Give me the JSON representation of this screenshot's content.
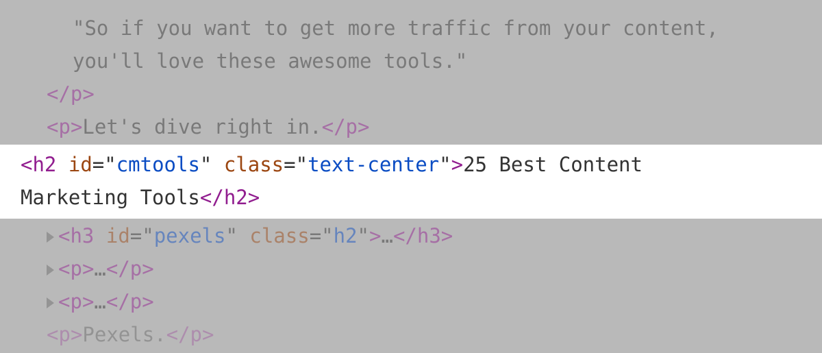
{
  "lines": {
    "text1": "\"So if you want to get more traffic from your content, ",
    "text2": "you'll love these awesome tools.\"",
    "close_p": "</",
    "close_p_name": "p",
    "close_p_end": ">",
    "p_open_l4": "<",
    "p_name_l4": "p",
    "p_gt_l4": ">",
    "p_content_l4": "Let's dive right in.",
    "p_close_l4_open": "</",
    "p_close_l4_name": "p",
    "p_close_l4_gt": ">",
    "h2_open": "<",
    "h2_name": "h2 ",
    "h2_id_attr": "id",
    "h2_eq1": "=\"",
    "h2_id_val": "cmtools",
    "h2_q1": "\" ",
    "h2_class_attr": "class",
    "h2_eq2": "=\"",
    "h2_class_val": "text-center",
    "h2_q2": "\"",
    "h2_gt": ">",
    "h2_text_a": "25 Best Content ",
    "h2_text_b": "Marketing Tools",
    "h2_close_open": "</",
    "h2_close_name": "h2",
    "h2_close_gt": ">",
    "h3_open": "<",
    "h3_name": "h3 ",
    "h3_id_attr": "id",
    "h3_eq1": "=\"",
    "h3_id_val": "pexels",
    "h3_q1": "\" ",
    "h3_class_attr": "class",
    "h3_eq2": "=\"",
    "h3_class_val": "h2",
    "h3_q2": "\"",
    "h3_gt": ">",
    "h3_ellipsis": "…",
    "h3_close_open": "</",
    "h3_close_name": "h3",
    "h3_close_gt": ">",
    "p_coll_open": "<",
    "p_coll_name": "p",
    "p_coll_gt": ">",
    "p_coll_ell": "…",
    "p_coll_close_open": "</",
    "p_coll_close_name": "p",
    "p_coll_close_gt": ">",
    "last_open": "<",
    "last_name": "p",
    "last_gt": ">",
    "last_text": "Pexels.",
    "last_close_open": "</",
    "last_close_name": "p",
    "last_close_gt": ">"
  }
}
